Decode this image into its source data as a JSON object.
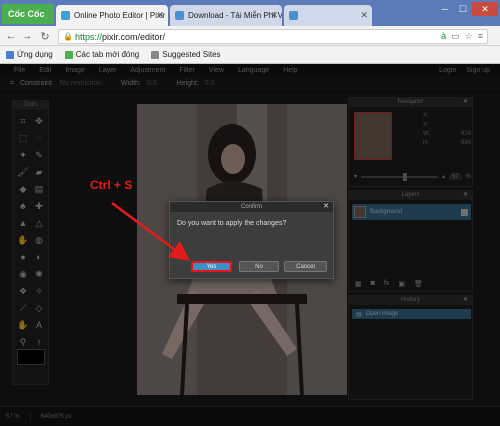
{
  "browser": {
    "brand": "Cốc Cốc",
    "tabs": [
      {
        "title": "Online Photo Editor | Pixlr",
        "color": "#3aa0d8"
      },
      {
        "title": "Download - Tải Miễn Phí V",
        "color": "#4a8fd0"
      },
      {
        "title": "",
        "color": "#cfd8e8"
      }
    ],
    "url_scheme": "https://",
    "url_domain": "pixlr.com",
    "url_path": "/editor/",
    "bookmarks": [
      "Ứng dụng",
      "Các tab mới đóng",
      "Suggested Sites"
    ]
  },
  "pixlr": {
    "menu": [
      "File",
      "Edit",
      "Image",
      "Layer",
      "Adjustment",
      "Filter",
      "View",
      "Language",
      "Help"
    ],
    "menu_right": [
      "Login",
      "Sign up"
    ],
    "options": {
      "constraint_label": "Constraint:",
      "constraint_value": "No restriction",
      "width_label": "Width:",
      "width_value": "0.0",
      "height_label": "Height:",
      "height_value": "0.0"
    },
    "tools_title": "Tools",
    "navigator": {
      "title": "Navigator",
      "x_label": "X:",
      "y_label": "Y:",
      "w_label": "W:",
      "w_value": "624",
      "h_label": "H:",
      "h_value": "984",
      "zoom": "57",
      "zoom_unit": "%",
      "zoom_level": 0.57
    },
    "layers": {
      "title": "Layers",
      "item": "Background"
    },
    "history": {
      "title": "History",
      "item": "Open image"
    },
    "status": {
      "zoom": "57 %",
      "size": "640x875 px"
    }
  },
  "dialog": {
    "title": "Confirm",
    "message": "Do you want to apply the changes?",
    "yes": "Yes",
    "no": "No",
    "cancel": "Cancel"
  },
  "annotation": {
    "text": "Ctrl + S",
    "color": "#e31b1b"
  }
}
